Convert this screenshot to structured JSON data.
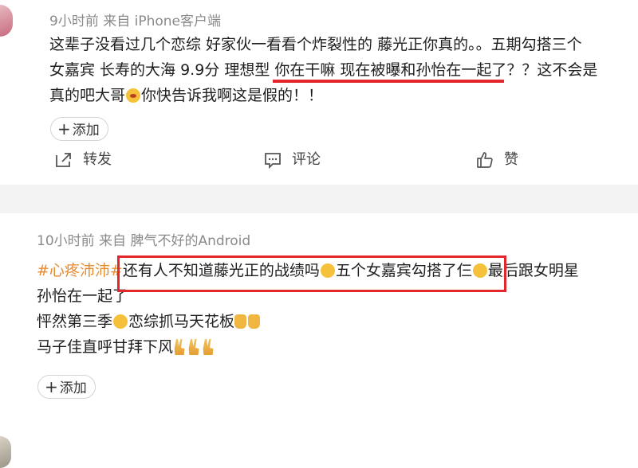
{
  "posts": [
    {
      "meta": "9小时前  来自 iPhone客户端",
      "lines": [
        "这辈子没看过几个恋综 好家伙一看看个炸裂性的 藤光正你真的。。五期勾搭三个",
        "女嘉宾 长寿的大海 9.9分 理想型 你在干嘛 现在被曝和孙怡在一起了？？这不会是",
        "真的吧大哥",
        "你快告诉我啊这是假的！！"
      ],
      "add_label": "添加",
      "actions": {
        "repost": "转发",
        "comment": "评论",
        "like": "赞"
      }
    },
    {
      "meta": "10小时前  来自 脾气不好的Android",
      "tag": "#心疼沛沛#",
      "line1_a": "还有人不知道藤光正的战绩吗",
      "line1_b": "五个女嘉宾勾搭了仨",
      "line1_c": "最后跟女明星",
      "line2": "孙怡在一起了",
      "line3_a": "怦然第三季",
      "line3_b": "恋综抓马天花板",
      "line4": "马子佳直呼甘拜下风",
      "add_label": "添加"
    }
  ],
  "colors": {
    "highlight": "#e3262b",
    "tag": "#e88b2e"
  }
}
